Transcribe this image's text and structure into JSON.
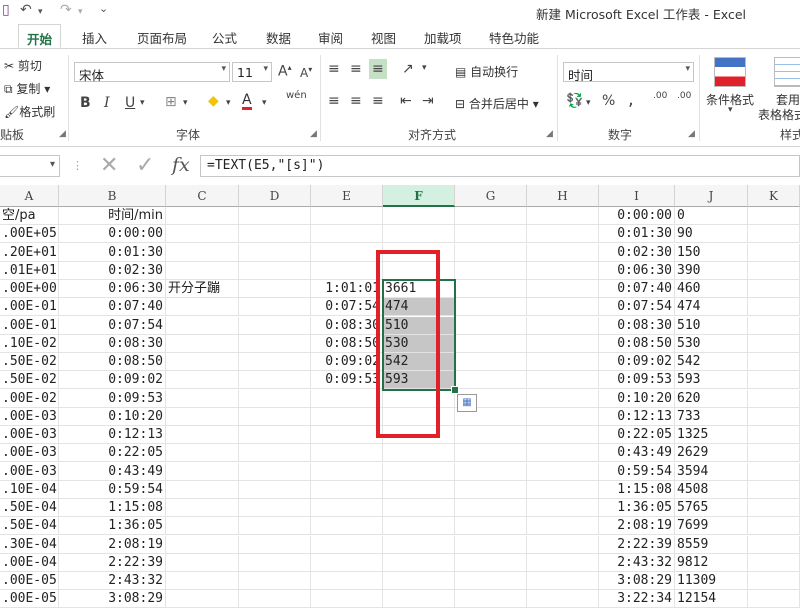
{
  "window": {
    "title": "新建 Microsoft Excel 工作表 - Excel"
  },
  "quick_access": {
    "undo_icon": "↶",
    "redo_icon": "↷",
    "customize_icon": "⌄"
  },
  "tabs": [
    "开始",
    "插入",
    "页面布局",
    "公式",
    "数据",
    "审阅",
    "视图",
    "加载项",
    "特色功能"
  ],
  "ribbon": {
    "clipboard": {
      "cut": "剪切",
      "copy": "复制",
      "format_painter": "格式刷",
      "label": "贴板"
    },
    "font": {
      "name": "宋体",
      "size": "11",
      "grow": "A",
      "shrink": "A",
      "bold": "B",
      "italic": "I",
      "underline": "U",
      "phonetic": "wén",
      "label": "字体"
    },
    "alignment": {
      "wrap": "自动换行",
      "merge": "合并后居中",
      "label": "对齐方式"
    },
    "number": {
      "format": "时间",
      "percent": "%",
      "comma": ",",
      "inc": ".00",
      "label": "数字"
    },
    "styles": {
      "conditional": "条件格式",
      "table": "套用",
      "table2": "表格格式",
      "label": "样式"
    }
  },
  "formula_bar": {
    "formula": "=TEXT(E5,\"[s]\")",
    "fx": "fx"
  },
  "columns": [
    "A",
    "B",
    "C",
    "D",
    "E",
    "F",
    "G",
    "H",
    "I",
    "J",
    "K"
  ],
  "selected_column": "F",
  "rows": [
    {
      "A": "空/pa",
      "B": "时间/min",
      "C": "",
      "E": "",
      "F": "",
      "I": "0:00:00",
      "J": "0"
    },
    {
      "A": ".00E+05",
      "B": "0:00:00",
      "C": "",
      "E": "",
      "F": "",
      "I": "0:01:30",
      "J": "90"
    },
    {
      "A": ".20E+01",
      "B": "0:01:30",
      "C": "",
      "E": "",
      "F": "",
      "I": "0:02:30",
      "J": "150"
    },
    {
      "A": ".01E+01",
      "B": "0:02:30",
      "C": "",
      "E": "",
      "F": "",
      "I": "0:06:30",
      "J": "390"
    },
    {
      "A": ".00E+00",
      "B": "0:06:30",
      "C": "开分子蹦",
      "E": "1:01:01",
      "F": "3661",
      "I": "0:07:40",
      "J": "460"
    },
    {
      "A": ".00E-01",
      "B": "0:07:40",
      "C": "",
      "E": "0:07:54",
      "F": "474",
      "I": "0:07:54",
      "J": "474"
    },
    {
      "A": ".00E-01",
      "B": "0:07:54",
      "C": "",
      "E": "0:08:30",
      "F": "510",
      "I": "0:08:30",
      "J": "510"
    },
    {
      "A": ".10E-02",
      "B": "0:08:30",
      "C": "",
      "E": "0:08:50",
      "F": "530",
      "I": "0:08:50",
      "J": "530"
    },
    {
      "A": ".50E-02",
      "B": "0:08:50",
      "C": "",
      "E": "0:09:02",
      "F": "542",
      "I": "0:09:02",
      "J": "542"
    },
    {
      "A": ".50E-02",
      "B": "0:09:02",
      "C": "",
      "E": "0:09:53",
      "F": "593",
      "I": "0:09:53",
      "J": "593"
    },
    {
      "A": ".00E-02",
      "B": "0:09:53",
      "C": "",
      "E": "",
      "F": "",
      "I": "0:10:20",
      "J": "620"
    },
    {
      "A": ".00E-03",
      "B": "0:10:20",
      "C": "",
      "E": "",
      "F": "",
      "I": "0:12:13",
      "J": "733"
    },
    {
      "A": ".00E-03",
      "B": "0:12:13",
      "C": "",
      "E": "",
      "F": "",
      "I": "0:22:05",
      "J": "1325"
    },
    {
      "A": ".00E-03",
      "B": "0:22:05",
      "C": "",
      "E": "",
      "F": "",
      "I": "0:43:49",
      "J": "2629"
    },
    {
      "A": ".00E-03",
      "B": "0:43:49",
      "C": "",
      "E": "",
      "F": "",
      "I": "0:59:54",
      "J": "3594"
    },
    {
      "A": ".10E-04",
      "B": "0:59:54",
      "C": "",
      "E": "",
      "F": "",
      "I": "1:15:08",
      "J": "4508"
    },
    {
      "A": ".50E-04",
      "B": "1:15:08",
      "C": "",
      "E": "",
      "F": "",
      "I": "1:36:05",
      "J": "5765"
    },
    {
      "A": ".50E-04",
      "B": "1:36:05",
      "C": "",
      "E": "",
      "F": "",
      "I": "2:08:19",
      "J": "7699"
    },
    {
      "A": ".30E-04",
      "B": "2:08:19",
      "C": "",
      "E": "",
      "F": "",
      "I": "2:22:39",
      "J": "8559"
    },
    {
      "A": ".00E-04",
      "B": "2:22:39",
      "C": "",
      "E": "",
      "F": "",
      "I": "2:43:32",
      "J": "9812"
    },
    {
      "A": ".00E-05",
      "B": "2:43:32",
      "C": "",
      "E": "",
      "F": "",
      "I": "3:08:29",
      "J": "11309"
    },
    {
      "A": ".00E-05",
      "B": "3:08:29",
      "C": "",
      "E": "",
      "F": "",
      "I": "3:22:34",
      "J": "12154"
    }
  ],
  "colors": {
    "accent": "#217346",
    "annotation": "#e0202a",
    "selection": "#c6c6c6"
  }
}
